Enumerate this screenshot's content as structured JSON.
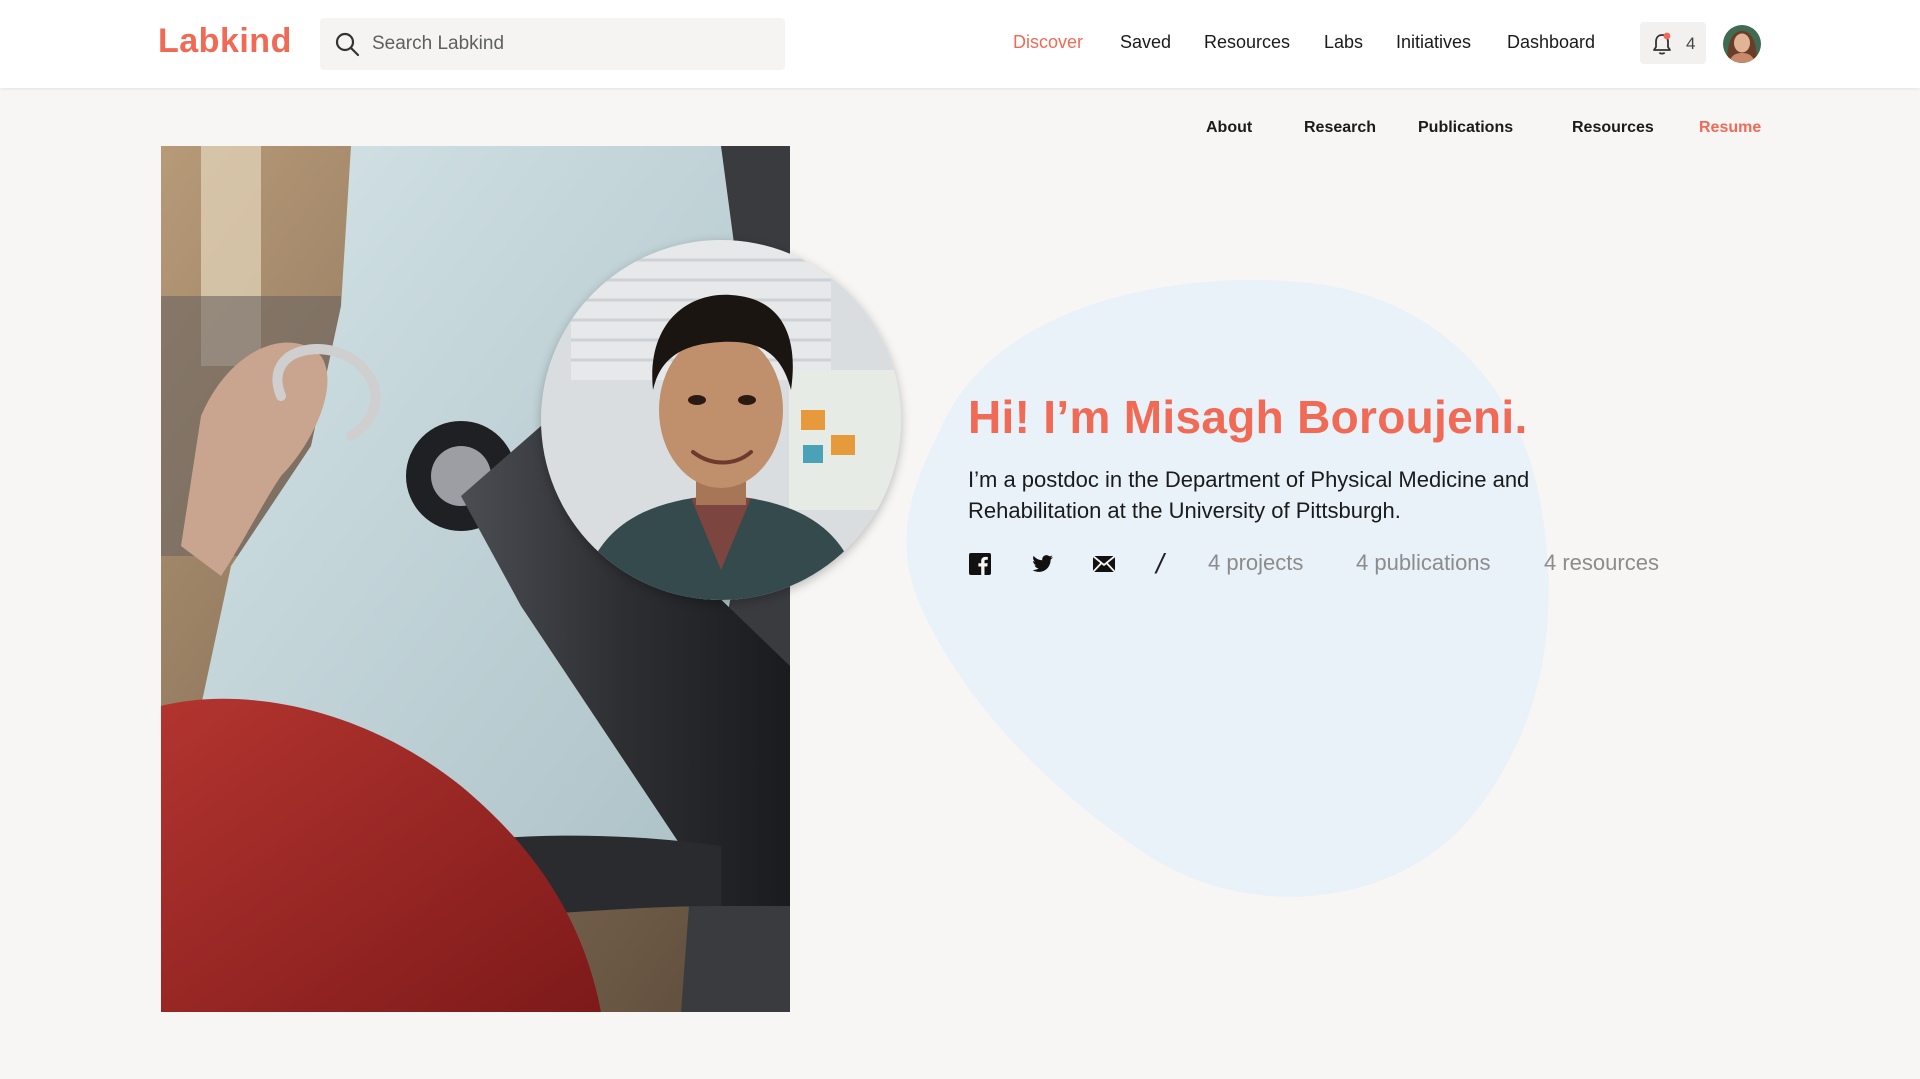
{
  "brand": {
    "name": "Labkind",
    "accent": "#f06a55",
    "blob": "#e9f1f9"
  },
  "search": {
    "placeholder": "Search Labkind",
    "icon": "search-icon"
  },
  "nav": {
    "items": [
      {
        "label": "Discover",
        "active": true
      },
      {
        "label": "Saved"
      },
      {
        "label": "Resources"
      },
      {
        "label": "Labs"
      },
      {
        "label": "Initiatives"
      },
      {
        "label": "Dashboard"
      }
    ],
    "notifications": {
      "icon": "bell-icon",
      "count": "4"
    },
    "avatar": "user-avatar"
  },
  "profile_nav": {
    "items": [
      {
        "label": "About"
      },
      {
        "label": "Research"
      },
      {
        "label": "Publications"
      },
      {
        "label": "Resources"
      },
      {
        "label": "Resume",
        "active": true
      }
    ]
  },
  "profile": {
    "heading": "Hi! I’m Misagh Boroujeni.",
    "bio": "I’m a postdoc in the Department of Physical Medicine and Rehabilitation at the University of Pittsburgh.",
    "social": [
      "facebook-icon",
      "twitter-icon",
      "mail-icon"
    ],
    "separator": "/",
    "stats": {
      "projects": "4 projects",
      "publications": "4 publications",
      "resources": "4 resources"
    }
  }
}
